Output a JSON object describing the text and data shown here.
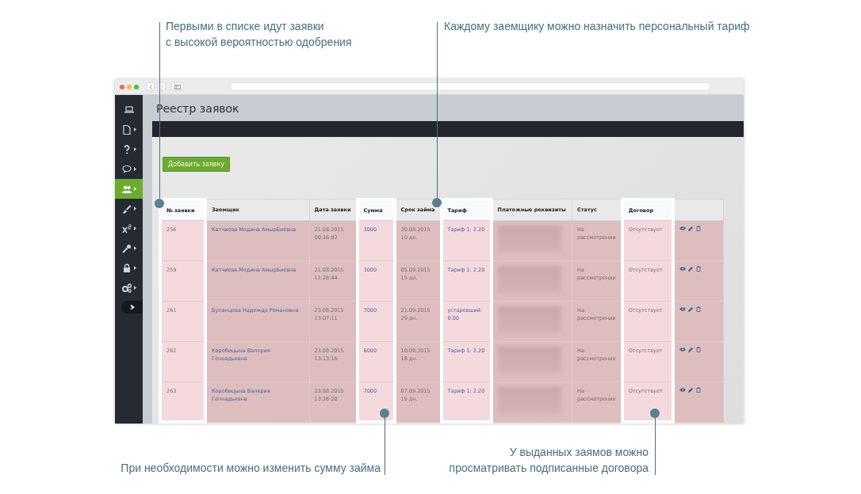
{
  "callouts": [
    {
      "lines": [
        "Первыми в списке идут заявки",
        "с высокой вероятностью одобрения"
      ]
    },
    {
      "lines": [
        "Каждому заемщику можно назначить персональный тариф"
      ]
    },
    {
      "lines": [
        "При необходимости можно изменить сумму займа"
      ]
    },
    {
      "lines": [
        "У выданных заямов можно",
        "просматривать подписанные договора"
      ]
    }
  ],
  "sidebar": {
    "items": [
      {
        "selected": false
      },
      {
        "selected": false
      },
      {
        "selected": false
      },
      {
        "selected": false
      },
      {
        "selected": true
      },
      {
        "selected": false
      },
      {
        "selected": false
      },
      {
        "selected": false
      },
      {
        "selected": false
      },
      {
        "selected": false
      }
    ]
  },
  "page_title": "Реестр заявок",
  "add_button": "Добавить заявку",
  "table": {
    "columns": [
      {
        "label": "№ заявки",
        "highlighted": true
      },
      {
        "label": "Заемщик",
        "highlighted": false
      },
      {
        "label": "Дата заявки",
        "highlighted": false
      },
      {
        "label": "Сумма",
        "highlighted": true
      },
      {
        "label": "Срок займа",
        "highlighted": false
      },
      {
        "label": "Тариф",
        "highlighted": true
      },
      {
        "label": "Платежные реквизиты",
        "highlighted": false
      },
      {
        "label": "Статус",
        "highlighted": false
      },
      {
        "label": "Договор",
        "highlighted": true
      }
    ],
    "rows": [
      {
        "id": "256",
        "borrower": "Катчиева Медина АмырБиевна",
        "date": "21.08.2015",
        "time": "00:16:02",
        "amount": "3000",
        "due": "30.08.2015",
        "days": "10 дн.",
        "tariff": "Тариф 1: 2.20",
        "status": "На рассмотрении",
        "contract": "Отсутствует"
      },
      {
        "id": "259",
        "borrower": "Катчиева Медина АмырБиевна",
        "date": "21.08.2015",
        "time": "11:28:44",
        "amount": "3000",
        "due": "05.09.2015",
        "days": "15 дн.",
        "tariff": "Тариф 1: 2.20",
        "status": "На рассмотрении",
        "contract": "Отсутствует"
      },
      {
        "id": "261",
        "borrower": "Буланцева Надежда Романовна",
        "date": "23.08.2015",
        "time": "13:07:11",
        "amount": "7000",
        "due": "21.09.2015",
        "days": "29 дн.",
        "tariff": "устаревший: 0.00",
        "status": "На рассмотрении",
        "contract": "Отсутствует"
      },
      {
        "id": "262",
        "borrower": "Коробицына Валерия Геннадьевна",
        "date": "23.08.2015",
        "time": "13:13:16",
        "amount": "6000",
        "due": "10.09.2015",
        "days": "18 дн.",
        "tariff": "Тариф 1: 2.20",
        "status": "На рассмотрении",
        "contract": "Отсутствует"
      },
      {
        "id": "263",
        "borrower": "Коробицына Валерия Геннадьевна",
        "date": "23.08.2015",
        "time": "13:26:20",
        "amount": "7000",
        "due": "07.09.2015",
        "days": "15 дн.",
        "tariff": "Тариф 1: 2.20",
        "status": "На рассмотрении",
        "contract": "Отсутствует"
      }
    ]
  }
}
